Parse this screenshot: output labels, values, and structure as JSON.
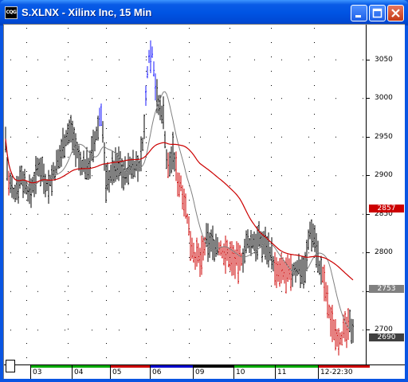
{
  "window": {
    "title": "S.XLNX - Xilinx Inc, 15 Min",
    "app_icon_label": "CQG"
  },
  "chart_data": {
    "type": "bar",
    "title": "S.XLNX - Xilinx Inc, 15 Min",
    "ylim": [
      2655,
      3095
    ],
    "yticks": [
      "3050",
      "3000",
      "2950",
      "2900",
      "2850",
      "2800",
      "2750",
      "2700"
    ],
    "xlabels": [
      "03",
      "04",
      "05",
      "06",
      "09",
      "10",
      "11",
      "12-22:30"
    ],
    "price_markers": [
      {
        "label": "2857",
        "value": 2857,
        "color": "#cc0000"
      },
      {
        "label": "2753",
        "value": 2753,
        "color": "#808080"
      },
      {
        "label": "2690",
        "value": 2690,
        "color": "#404040"
      }
    ],
    "series": [
      {
        "name": "price",
        "color": "#000000"
      },
      {
        "name": "ma-long",
        "color": "#cc0000"
      },
      {
        "name": "ma-short",
        "color": "#808080"
      }
    ]
  }
}
